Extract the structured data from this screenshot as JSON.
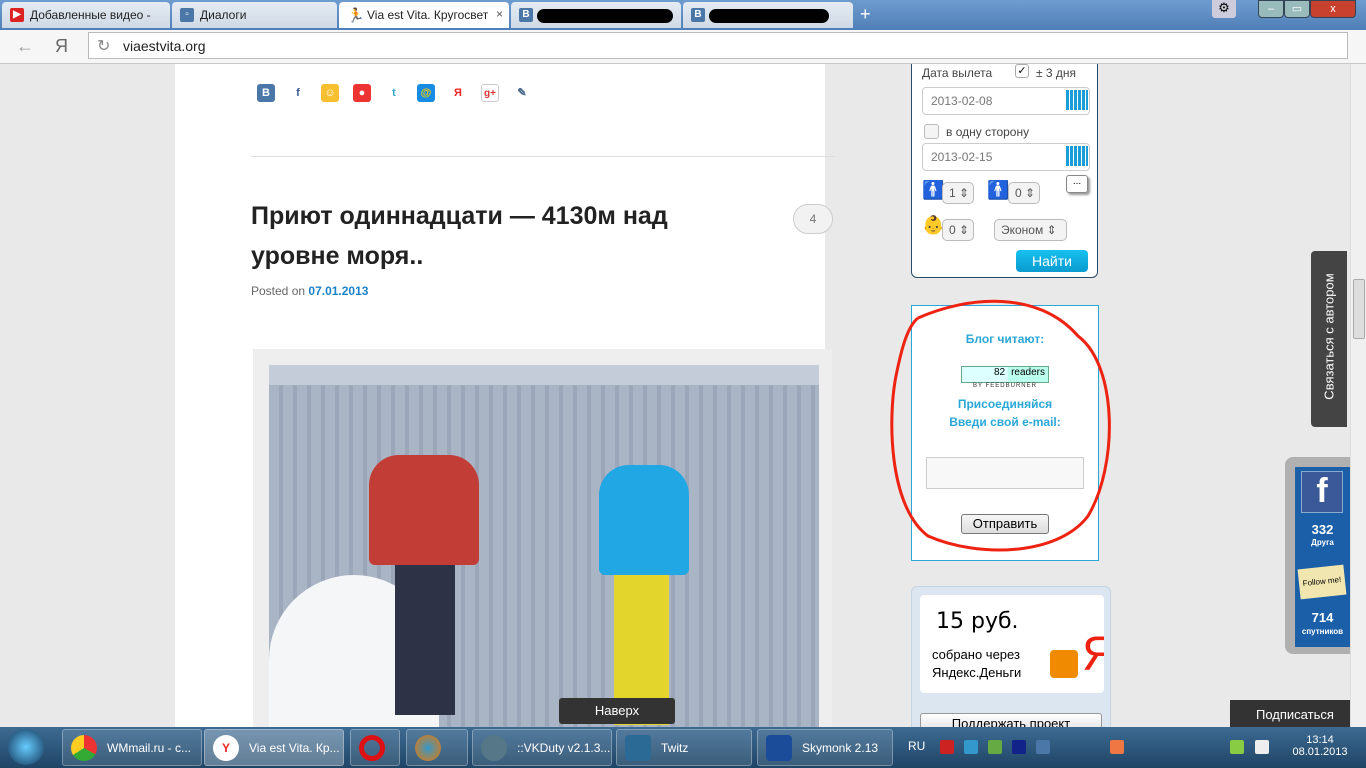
{
  "browser": {
    "tabs": [
      {
        "label": "Добавленные видео -"
      },
      {
        "label": "Диалоги"
      },
      {
        "label": "Via est Vita. Кругосвет"
      },
      {
        "label": ""
      },
      {
        "label": ""
      }
    ],
    "url": "viaestvita.org",
    "nav_logo": "Я"
  },
  "post": {
    "title": "Приют одиннадцати — 4130м над уровне моря..",
    "posted_on": "Posted on",
    "date": "07.01.2013",
    "comments": "4"
  },
  "share_icons": [
    "vk-icon",
    "facebook-icon",
    "odnoklassniki-icon",
    "chat-icon",
    "twitter-icon",
    "mail-icon",
    "yandex-icon",
    "googleplus-icon",
    "livejournal-icon"
  ],
  "flight": {
    "departure_label": "Дата вылета",
    "flex_label": "± 3 дня",
    "flex_checked": true,
    "depart_date": "2013-02-08",
    "oneway_label": "в одну сторону",
    "oneway_checked": false,
    "return_date": "2013-02-15",
    "adults": "1",
    "children": "0",
    "infants": "0",
    "class": "Эконом",
    "more": "...",
    "search": "Найти"
  },
  "subscribe": {
    "readers_label": "Блог читают:",
    "readers": "82",
    "readers_unit": "readers",
    "feedburner": "BY FEEDBURNER",
    "join": "Присоединяйся",
    "enter_email": "Введи свой e-mail:",
    "email_value": "",
    "submit": "Отправить"
  },
  "donate": {
    "amount": "15 руб.",
    "via": "собрано через",
    "service": "Яндекс.Деньги",
    "button": "Поддержать проект"
  },
  "social": {
    "fb_count": "332",
    "fb_label": "Друга",
    "tw_count": "714",
    "tw_label": "спутников",
    "follow": "Follow me!"
  },
  "contact_tab": "Связаться с автором",
  "scroll_top": "Наверх",
  "subscribe_btn": "Подписаться",
  "taskbar": {
    "items": [
      "WMmail.ru - с...",
      "Via est Vita. Кр...",
      "",
      "",
      "::VKDuty v2.1.3...",
      "Twitz",
      "Skymonk 2.13"
    ],
    "lang": "RU",
    "time": "13:14",
    "date": "08.01.2013"
  }
}
